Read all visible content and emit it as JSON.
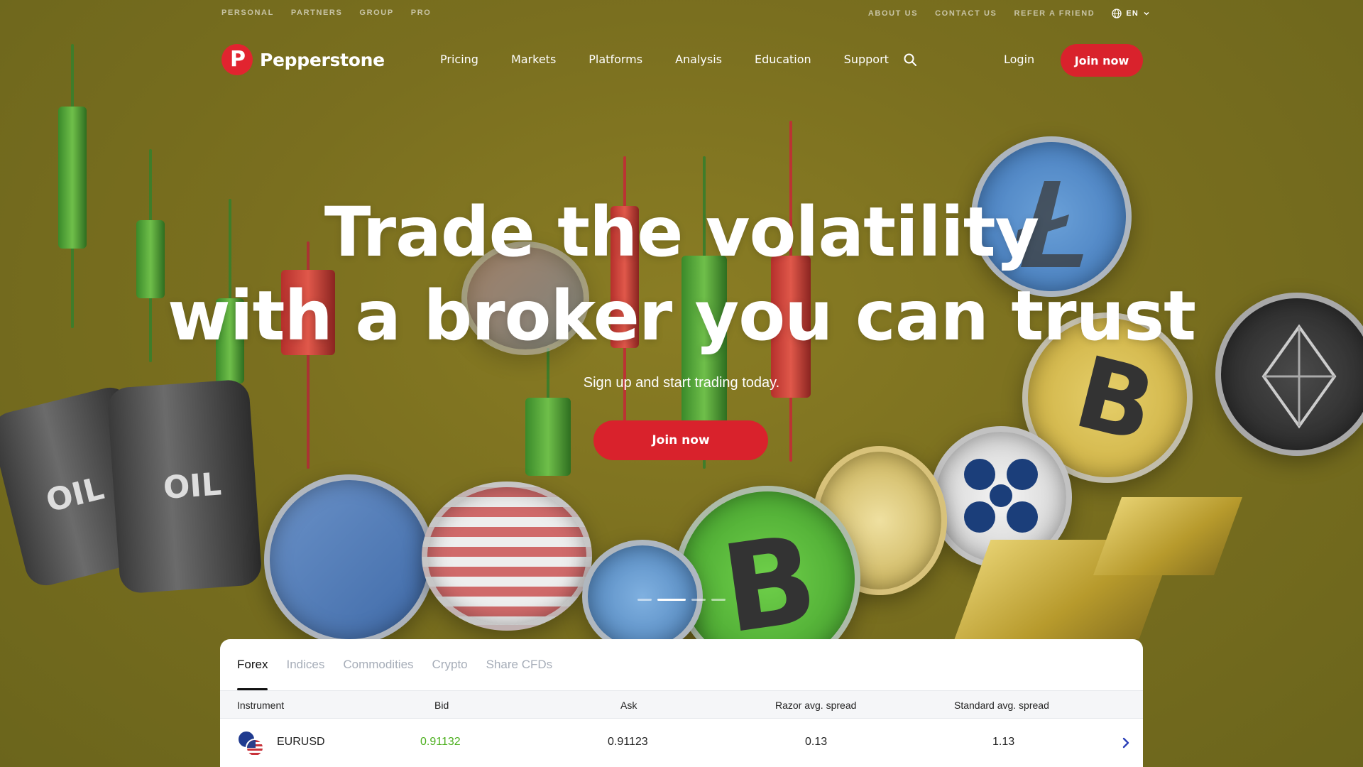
{
  "utility": {
    "left_links": [
      "PERSONAL",
      "PARTNERS",
      "GROUP",
      "PRO"
    ],
    "right_links": [
      "ABOUT US",
      "CONTACT US",
      "REFER A FRIEND"
    ],
    "language": "EN"
  },
  "nav": {
    "brand": "Pepperstone",
    "menu": [
      "Pricing",
      "Markets",
      "Platforms",
      "Analysis",
      "Education",
      "Support"
    ],
    "login": "Login",
    "join": "Join now"
  },
  "hero": {
    "headline_line1": "Trade the volatility",
    "headline_line2": "with a broker you can trust",
    "subline": "Sign up and start trading today.",
    "cta": "Join now",
    "carousel": {
      "slides": 4,
      "active_index": 1
    }
  },
  "prices": {
    "tabs": [
      "Forex",
      "Indices",
      "Commodities",
      "Crypto",
      "Share CFDs"
    ],
    "active_tab": "Forex",
    "columns": [
      "Instrument",
      "Bid",
      "Ask",
      "Razor avg. spread",
      "Standard avg. spread"
    ],
    "rows": [
      {
        "instrument": "EURUSD",
        "bid": "0.91132",
        "ask": "0.91123",
        "razor": "0.13",
        "standard": "1.13"
      }
    ],
    "bid_color": "#4caf1e"
  },
  "colors": {
    "brand_red": "#d9222c",
    "hero_bg": "#7b7420"
  },
  "icons": {
    "globe": "globe-icon",
    "search": "search-icon",
    "chevron": "chevron-right-icon"
  }
}
